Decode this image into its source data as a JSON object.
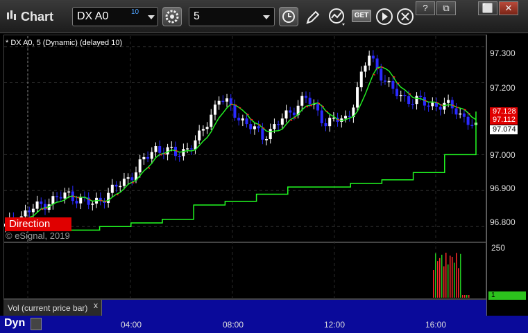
{
  "app": {
    "title": "Chart"
  },
  "toolbar": {
    "symbol": "DX A0",
    "symbol_sup": "10",
    "interval": "5",
    "get_label": "GET",
    "window_buttons": [
      "?",
      "⧉",
      "⬜",
      "✕"
    ]
  },
  "chart": {
    "study_label": "* DX A0, 5 (Dynamic) (delayed 10)",
    "direction_label": "Direction",
    "copyright": "© eSignal, 2019",
    "price_ticks": [
      "97.300",
      "97.200",
      "97.000",
      "96.900",
      "96.800"
    ],
    "badges": [
      {
        "value": "97.128",
        "bg": "#e00000",
        "fg": "#ffffff"
      },
      {
        "value": "97.112",
        "bg": "#e00000",
        "fg": "#ffffff"
      },
      {
        "value": "97.074",
        "bg": "#ffffff",
        "fg": "#000000"
      }
    ],
    "time_ticks": [
      "04:00",
      "08:00",
      "12:00",
      "16:00"
    ],
    "colors": {
      "up": "#ffffff",
      "down": "#2a2aff",
      "ma_red": "#ff2020",
      "ma_green": "#22ee22",
      "stop": "#22ff22"
    }
  },
  "volume": {
    "label": "Vol (current price bar)",
    "close": "x",
    "axis_max": "250",
    "current_badge": "1"
  },
  "footer": {
    "dyn": "Dyn"
  },
  "chart_data": {
    "type": "line",
    "x_labels": [
      "04:00",
      "08:00",
      "12:00",
      "16:00"
    ],
    "ylim": [
      96.76,
      97.33
    ],
    "series": [
      {
        "values": [
          96.8,
          96.84,
          96.87,
          96.89,
          96.86,
          96.9,
          96.95,
          97.02,
          97.0,
          97.04,
          97.16,
          97.1,
          97.05,
          97.1,
          97.16,
          97.09,
          97.1,
          97.28,
          97.18,
          97.15,
          97.14,
          97.13,
          97.07
        ]
      },
      {
        "values": [
          96.79,
          96.79,
          96.79,
          96.8,
          96.81,
          96.82,
          96.86,
          96.87,
          96.89,
          96.91,
          96.91,
          96.92,
          96.93,
          96.95,
          97.0,
          97.12
        ]
      }
    ]
  }
}
